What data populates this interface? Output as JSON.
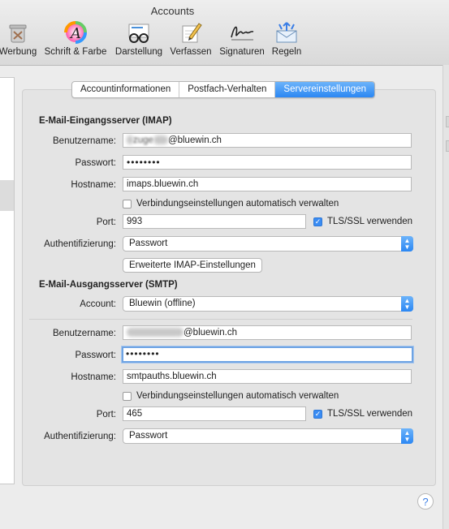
{
  "window": {
    "title": "Accounts"
  },
  "toolbar": {
    "items": [
      {
        "label": "Werbung",
        "icon": "junk-mail-icon"
      },
      {
        "label": "Schrift & Farbe",
        "icon": "fonts-colors-icon"
      },
      {
        "label": "Darstellung",
        "icon": "viewing-glasses-icon"
      },
      {
        "label": "Verfassen",
        "icon": "composing-pencil-icon"
      },
      {
        "label": "Signaturen",
        "icon": "signature-icon"
      },
      {
        "label": "Regeln",
        "icon": "rules-icon"
      }
    ]
  },
  "tabs": [
    {
      "label": "Accountinformationen",
      "active": false
    },
    {
      "label": "Postfach-Verhalten",
      "active": false
    },
    {
      "label": "Servereinstellungen",
      "active": true
    }
  ],
  "imap": {
    "title": "E-Mail-Eingangsserver (IMAP)",
    "username_label": "Benutzername:",
    "username_visible_text": "@bluewin.ch",
    "username_partial": "zuge",
    "password_label": "Passwort:",
    "password_mask": "••••••••",
    "hostname_label": "Hostname:",
    "hostname_value": "imaps.bluewin.ch",
    "auto_manage_label": "Verbindungseinstellungen automatisch verwalten",
    "auto_manage_checked": false,
    "port_label": "Port:",
    "port_value": "993",
    "tls_label": "TLS/SSL verwenden",
    "tls_checked": true,
    "auth_label": "Authentifizierung:",
    "auth_value": "Passwort",
    "advanced_button": "Erweiterte IMAP-Einstellungen"
  },
  "smtp": {
    "title": "E-Mail-Ausgangsserver (SMTP)",
    "account_label": "Account:",
    "account_value": "Bluewin (offline)",
    "username_label": "Benutzername:",
    "username_visible_text": "@bluewin.ch",
    "password_label": "Passwort:",
    "password_mask": "••••••••",
    "hostname_label": "Hostname:",
    "hostname_value": "smtpauths.bluewin.ch",
    "auto_manage_label": "Verbindungseinstellungen automatisch verwalten",
    "auto_manage_checked": false,
    "port_label": "Port:",
    "port_value": "465",
    "tls_label": "TLS/SSL verwenden",
    "tls_checked": true,
    "auth_label": "Authentifizierung:",
    "auth_value": "Passwort"
  },
  "help": {
    "label": "?"
  },
  "colors": {
    "accent": "#2b87f3",
    "focus_ring": "#6ea3e3"
  }
}
